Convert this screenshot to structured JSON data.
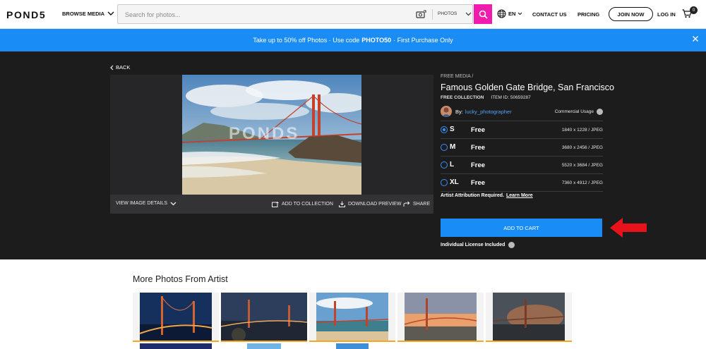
{
  "header": {
    "logo": "POND5",
    "browse_label": "BROWSE MEDIA",
    "search_placeholder": "Search for photos...",
    "search_type": "PHOTOS",
    "language": "EN",
    "contact_label": "CONTACT US",
    "pricing_label": "PRICING",
    "join_label": "JOIN NOW",
    "login_label": "LOG IN",
    "cart_count": "0"
  },
  "promo": {
    "text_before": "Take up to 50% off Photos · Use code",
    "code": "PHOTO50",
    "text_after": "· First Purchase Only"
  },
  "viewer": {
    "back_label": "BACK",
    "watermark": "PONDS",
    "view_details_label": "VIEW IMAGE DETAILS",
    "add_collection_label": "ADD TO COLLECTION",
    "download_preview_label": "DOWNLOAD PREVIEW",
    "share_label": "SHARE"
  },
  "info": {
    "breadcrumb": "FREE MEDIA  /",
    "title": "Famous Golden Gate Bridge, San Francisco",
    "collection": "FREE COLLECTION",
    "item_id": "ITEM ID: 50659287",
    "by_label": "By:",
    "artist_name": "lucky_photographer",
    "usage_label": "Commercial Usage",
    "sizes": [
      {
        "size": "S",
        "price": "Free",
        "dims": "1840 x 1228 / JPEG",
        "selected": true
      },
      {
        "size": "M",
        "price": "Free",
        "dims": "3680 x 2456 / JPEG",
        "selected": false
      },
      {
        "size": "L",
        "price": "Free",
        "dims": "5520 x 3684 / JPEG",
        "selected": false
      },
      {
        "size": "XL",
        "price": "Free",
        "dims": "7360 x 4912 / JPEG",
        "selected": false
      }
    ],
    "attribution_text": "Artist Attribution Required.",
    "learn_more_label": "Learn More",
    "add_to_cart_label": "ADD TO CART",
    "license_label": "Individual License Included"
  },
  "more": {
    "title": "More Photos From Artist"
  },
  "colors": {
    "accent_blue": "#1a8cf5",
    "search_pink": "#f01cad",
    "arrow_red": "#e8121a",
    "thumb_bar": "#f5a623",
    "dark_bg": "#1c1c1c"
  }
}
